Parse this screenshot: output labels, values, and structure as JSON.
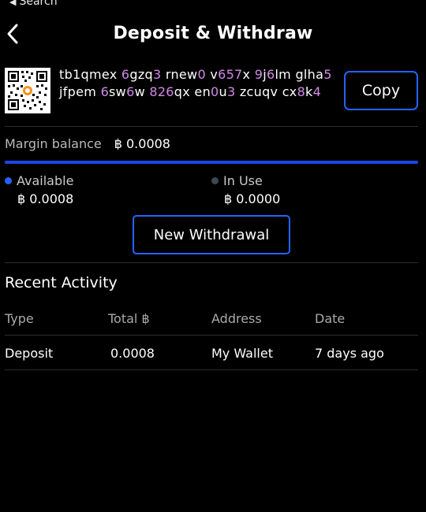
{
  "status_bar": {
    "back_label": "Search"
  },
  "header": {
    "title": "Deposit & Withdraw"
  },
  "deposit_address": {
    "segments": [
      {
        "t": "tb1qmex",
        "c": "w"
      },
      {
        "t": " ",
        "c": "w"
      },
      {
        "t": "6",
        "c": "d"
      },
      {
        "t": "gzq",
        "c": "w"
      },
      {
        "t": "3",
        "c": "d"
      },
      {
        "t": " ",
        "c": "w"
      },
      {
        "t": "rnew",
        "c": "w"
      },
      {
        "t": "0",
        "c": "d"
      },
      {
        "t": " ",
        "c": "w"
      },
      {
        "t": "v",
        "c": "w"
      },
      {
        "t": "657",
        "c": "d"
      },
      {
        "t": "x",
        "c": "w"
      },
      {
        "t": " ",
        "c": "w"
      },
      {
        "t": "9",
        "c": "d"
      },
      {
        "t": "j",
        "c": "w"
      },
      {
        "t": "6",
        "c": "d"
      },
      {
        "t": "lm",
        "c": "w"
      },
      {
        "t": " ",
        "c": "w"
      },
      {
        "t": "glha",
        "c": "w"
      },
      {
        "t": "5",
        "c": "d"
      },
      {
        "t": " ",
        "c": "w"
      },
      {
        "t": "jfpem",
        "c": "w"
      },
      {
        "t": " ",
        "c": "w"
      },
      {
        "t": "6",
        "c": "d"
      },
      {
        "t": "sw",
        "c": "w"
      },
      {
        "t": "6",
        "c": "d"
      },
      {
        "t": "w",
        "c": "w"
      },
      {
        "t": " ",
        "c": "w"
      },
      {
        "t": "826",
        "c": "d"
      },
      {
        "t": "qx",
        "c": "w"
      },
      {
        "t": " ",
        "c": "w"
      },
      {
        "t": "en",
        "c": "w"
      },
      {
        "t": "0",
        "c": "d"
      },
      {
        "t": "u",
        "c": "w"
      },
      {
        "t": "3",
        "c": "d"
      },
      {
        "t": " ",
        "c": "w"
      },
      {
        "t": "zcuqv",
        "c": "w"
      },
      {
        "t": " ",
        "c": "w"
      },
      {
        "t": "cx",
        "c": "w"
      },
      {
        "t": "8",
        "c": "d"
      },
      {
        "t": "k",
        "c": "w"
      },
      {
        "t": "4",
        "c": "d"
      }
    ],
    "copy_label": "Copy"
  },
  "margin": {
    "label": "Margin balance",
    "value": "฿ 0.0008",
    "available_fraction": 1.0
  },
  "balances": {
    "available": {
      "label": "Available",
      "value": "฿ 0.0008"
    },
    "in_use": {
      "label": "In Use",
      "value": "฿ 0.0000"
    }
  },
  "actions": {
    "new_withdrawal": "New Withdrawal"
  },
  "activity": {
    "title": "Recent Activity",
    "columns": [
      "Type",
      "Total ฿",
      "Address",
      "Date"
    ],
    "rows": [
      [
        "Deposit",
        "0.0008",
        "My Wallet",
        "7 days ago"
      ]
    ]
  },
  "colors": {
    "accent": "#2463ff",
    "progress": "#1d47e8",
    "address_digit": "#d48ae6",
    "available_dot": "#2463ff",
    "in_use_dot": "#3a4a55"
  }
}
